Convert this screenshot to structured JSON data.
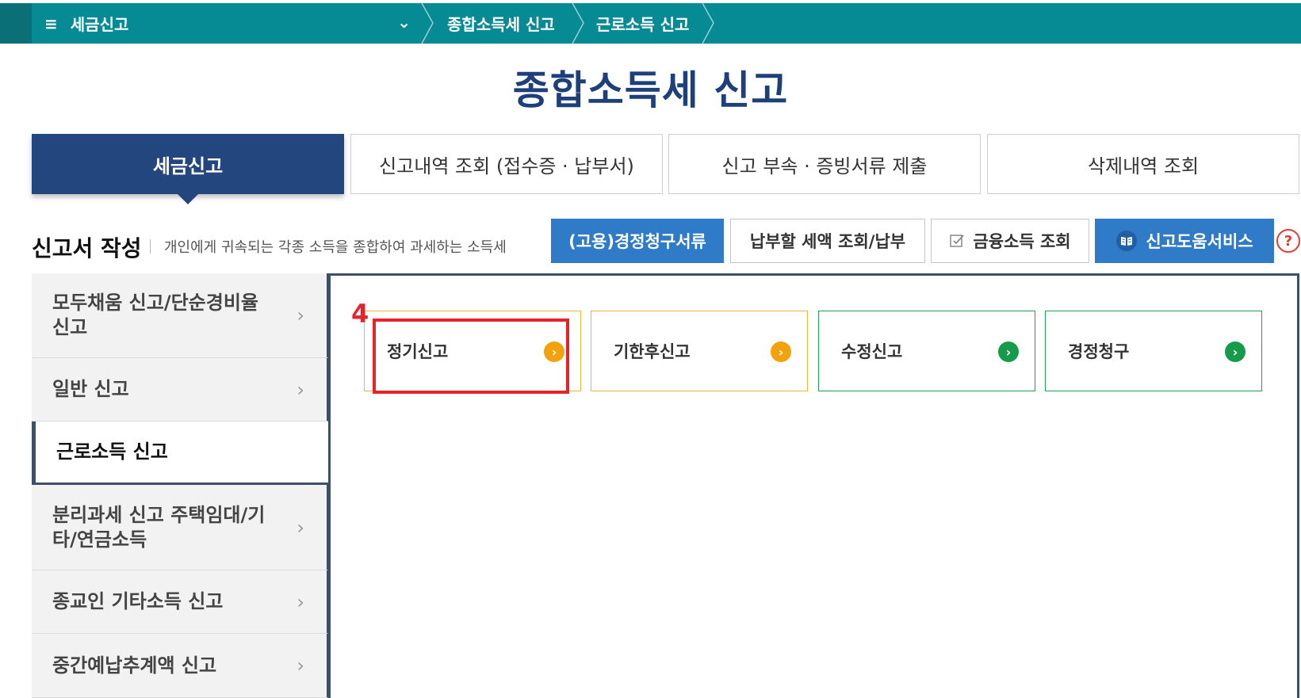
{
  "topbar": {
    "menu_label": "세금신고",
    "menu_icon": "hamburger-icon",
    "breadcrumbs": [
      "종합소득세 신고",
      "근로소득 신고"
    ]
  },
  "page_title": "종합소득세 신고",
  "tabs": [
    {
      "label": "세금신고",
      "active": true
    },
    {
      "label": "신고내역 조회 (접수증 · 납부서)",
      "active": false
    },
    {
      "label": "신고 부속 · 증빙서류 제출",
      "active": false
    },
    {
      "label": "삭제내역 조회",
      "active": false
    }
  ],
  "section": {
    "title": "신고서 작성",
    "description": "개인에게 귀속되는 각종 소득을 종합하여 과세하는 소득세"
  },
  "actions": {
    "claim_docs": "(고용)경정청구서류",
    "tax_payment": "납부할 세액 조회/납부",
    "financial_income": "금융소득 조회",
    "help_service": "신고도움서비스",
    "help_mark": "?"
  },
  "side_menu": [
    {
      "label": "모두채움 신고/단순경비율 신고",
      "active": false
    },
    {
      "label": "일반 신고",
      "active": false
    },
    {
      "label": "근로소득 신고",
      "active": true
    },
    {
      "label": "분리과세 신고 주택임대/기타/연금소득",
      "active": false
    },
    {
      "label": "종교인 기타소득 신고",
      "active": false
    },
    {
      "label": "중간예납추계액 신고",
      "active": false
    }
  ],
  "cards": [
    {
      "label": "정기신고",
      "color": "#f2a20c"
    },
    {
      "label": "기한후신고",
      "color": "#f2a20c"
    },
    {
      "label": "수정신고",
      "color": "#169b4a"
    },
    {
      "label": "경정청구",
      "color": "#169b4a"
    }
  ],
  "annotation": {
    "step": "4",
    "color": "#e3242b"
  },
  "colors": {
    "topbar": "#068a93",
    "title": "#1d3f7a",
    "active_tab": "#24467f",
    "action_blue": "#2f7bc7"
  }
}
